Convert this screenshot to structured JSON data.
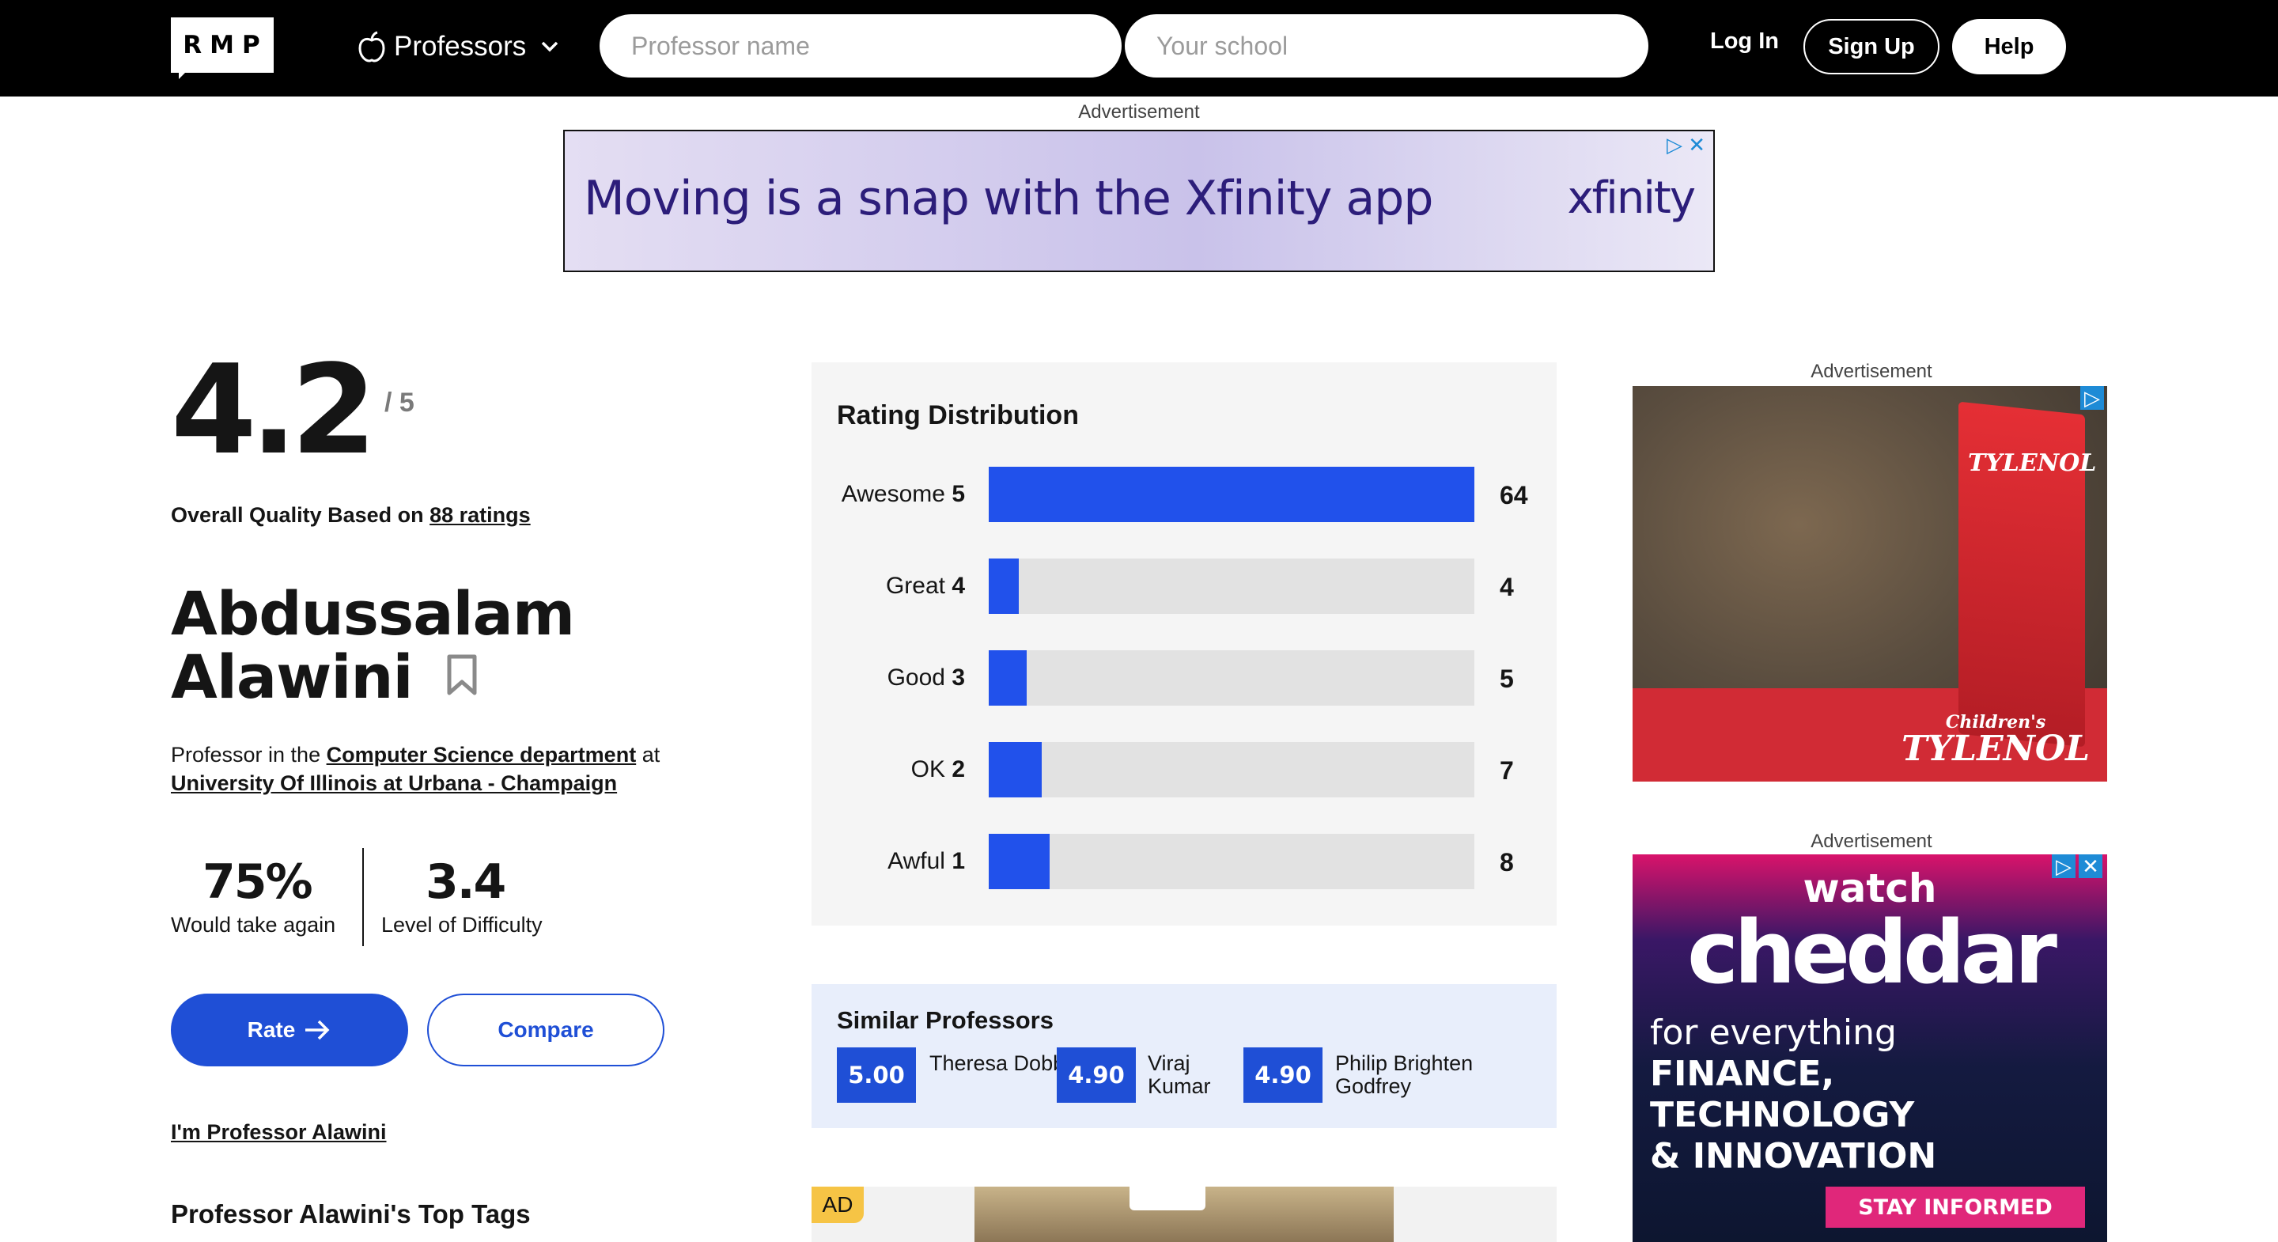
{
  "header": {
    "logo_text": "RMP",
    "category_label": "Professors",
    "search_professor_placeholder": "Professor name",
    "search_school_placeholder": "Your school",
    "login_label": "Log In",
    "signup_label": "Sign Up",
    "help_label": "Help"
  },
  "ads": {
    "label": "Advertisement",
    "top_banner": {
      "text": "Moving is a snap with the Xfinity app",
      "brand": "xfinity"
    },
    "right_ad_1": {
      "brand_line1": "Children's",
      "brand_line2": "TYLENOL",
      "box_text": "TYLENOL"
    },
    "right_ad_2": {
      "watch": "watch",
      "brand": "cheddar",
      "tagline_1": "for everything",
      "tagline_2": "FINANCE, TECHNOLOGY",
      "tagline_3": "& INNOVATION",
      "cta": "STAY INFORMED"
    },
    "bottom_tag": "AD"
  },
  "rating": {
    "score": "4.2",
    "max": "/ 5",
    "quality_prefix": "Overall Quality Based on ",
    "ratings_link": "88 ratings"
  },
  "professor": {
    "first_name": "Abdussalam",
    "last_name": "Alawini",
    "dept_prefix": "Professor in the ",
    "department": "Computer Science department",
    "dept_mid": " at",
    "school": "University Of Illinois at Urbana - Champaign"
  },
  "stats": {
    "take_again_value": "75%",
    "take_again_label": "Would take again",
    "difficulty_value": "3.4",
    "difficulty_label": "Level of Difficulty"
  },
  "actions": {
    "rate_label": "Rate",
    "compare_label": "Compare",
    "claim_label": "I'm Professor Alawini",
    "top_tags_heading": "Professor Alawini's Top Tags"
  },
  "distribution": {
    "title": "Rating Distribution",
    "max_count": 64,
    "rows": [
      {
        "label": "Awesome",
        "score": "5",
        "count": 64
      },
      {
        "label": "Great",
        "score": "4",
        "count": 4
      },
      {
        "label": "Good",
        "score": "3",
        "count": 5
      },
      {
        "label": "OK",
        "score": "2",
        "count": 7
      },
      {
        "label": "Awful",
        "score": "1",
        "count": 8
      }
    ]
  },
  "similar": {
    "title": "Similar Professors",
    "items": [
      {
        "rating": "5.00",
        "name": "Theresa Dobbs"
      },
      {
        "rating": "4.90",
        "name": "Viraj Kumar"
      },
      {
        "rating": "4.90",
        "name": "Philip Brighten Godfrey"
      }
    ]
  },
  "colors": {
    "accent": "#1f4fd6",
    "bar_fill": "#2151eb",
    "bar_track": "#e2e2e2",
    "header_bg": "#000000"
  }
}
